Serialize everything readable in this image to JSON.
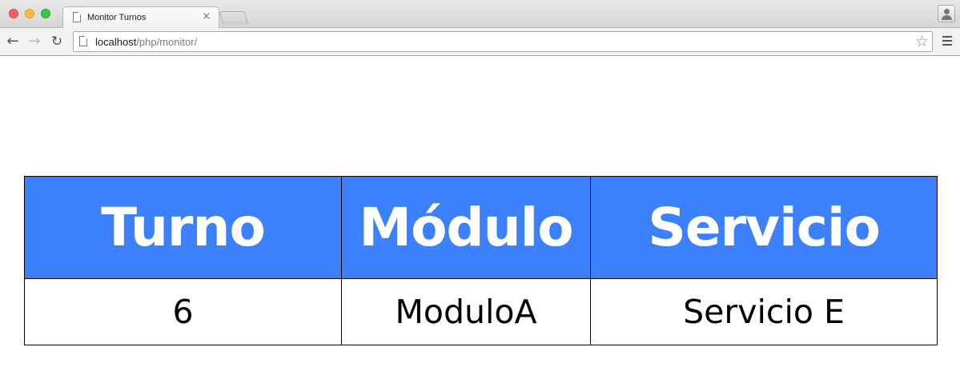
{
  "browser": {
    "tab_title": "Monitor Turnos",
    "tab_close": "×",
    "url_host": "localhost",
    "url_path": "/php/monitor/",
    "icons": {
      "back": "arrow-left",
      "forward": "arrow-right",
      "reload": "reload",
      "bookmark": "star",
      "menu": "hamburger",
      "profile": "person"
    }
  },
  "table": {
    "header_color": "#3c80fc",
    "headers": [
      "Turno",
      "Módulo",
      "Servicio"
    ],
    "rows": [
      [
        "6",
        "ModuloA",
        "Servicio E"
      ]
    ]
  }
}
